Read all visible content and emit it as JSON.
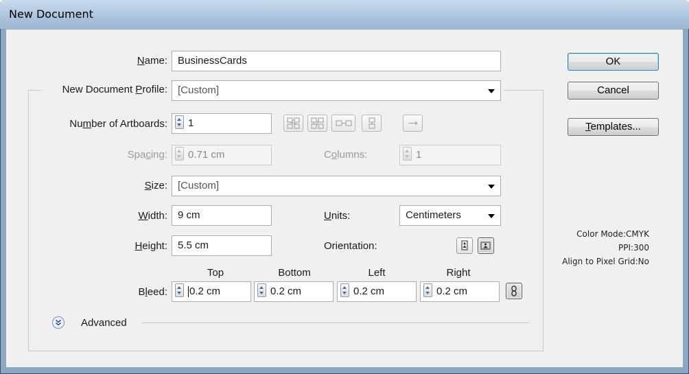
{
  "window": {
    "title": "New Document"
  },
  "name": {
    "label_pre": "",
    "label_u": "N",
    "label_post": "ame:",
    "value": "BusinessCards"
  },
  "profile": {
    "label_pre": "New Document ",
    "label_u": "P",
    "label_post": "rofile:",
    "value": "[Custom]"
  },
  "artboards": {
    "label_pre": "Nu",
    "label_u": "m",
    "label_post": "ber of Artboards:",
    "value": "1"
  },
  "spacing": {
    "label_pre": "Spa",
    "label_u": "c",
    "label_post": "ing:",
    "value": "0.71 cm"
  },
  "columns": {
    "label_pre": "C",
    "label_u": "o",
    "label_post": "lumns:",
    "value": "1"
  },
  "size": {
    "label_pre": "",
    "label_u": "S",
    "label_post": "ize:",
    "value": "[Custom]"
  },
  "width": {
    "label_pre": "",
    "label_u": "W",
    "label_post": "idth:",
    "value": "9 cm"
  },
  "units": {
    "label_pre": "",
    "label_u": "U",
    "label_post": "nits:",
    "value": "Centimeters"
  },
  "height": {
    "label_pre": "",
    "label_u": "H",
    "label_post": "eight:",
    "value": "5.5 cm"
  },
  "orientation": {
    "label": "Orientation:",
    "selected": "landscape"
  },
  "bleed": {
    "label_pre": "B",
    "label_u": "l",
    "label_post": "eed:",
    "headers": [
      "Top",
      "Bottom",
      "Left",
      "Right"
    ],
    "values": [
      "0.2 cm",
      "0.2 cm",
      "0.2 cm",
      "0.2 cm"
    ]
  },
  "advanced": {
    "label": "Advanced"
  },
  "buttons": {
    "ok": "OK",
    "cancel": "Cancel",
    "templates_u": "T",
    "templates_post": "emplates..."
  },
  "info": {
    "color_mode": "Color Mode:CMYK",
    "ppi": "PPI:300",
    "pixel_grid": "Align to Pixel Grid:No"
  },
  "icons": {
    "artboard_layout": [
      "grid-by-row-icon",
      "grid-by-column-icon",
      "arrange-by-row-icon",
      "arrange-by-column-icon",
      "right-to-left-layout-icon"
    ],
    "orientation": [
      "portrait-icon",
      "landscape-icon"
    ],
    "bleed_link": "link-chain-icon",
    "advanced_toggle": "chevron-down-circle-icon"
  },
  "colors": {
    "accent": "#3c7fb1",
    "titlebar": "#aac3dc"
  }
}
